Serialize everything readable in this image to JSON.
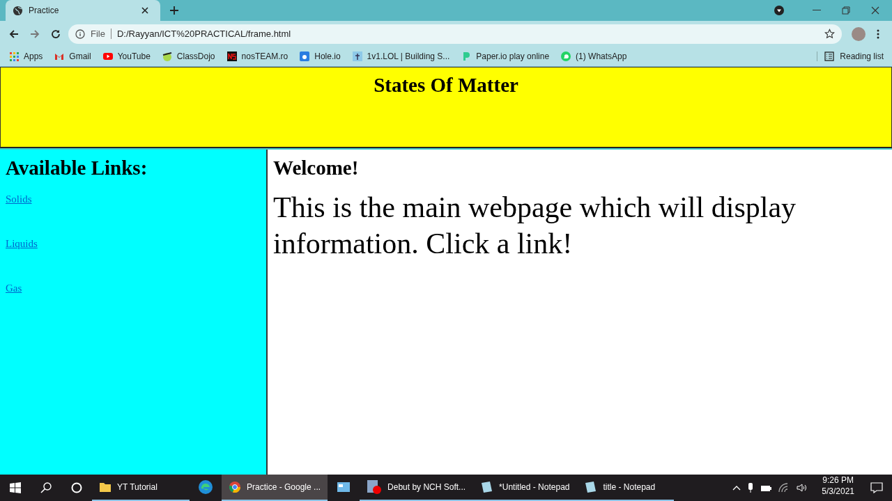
{
  "browser": {
    "tab": {
      "title": "Practice"
    },
    "address": {
      "scheme": "File",
      "url": "D:/Rayyan/ICT%20PRACTICAL/frame.html"
    },
    "bookmarks": [
      {
        "label": "Apps",
        "kind": "apps"
      },
      {
        "label": "Gmail",
        "kind": "gmail"
      },
      {
        "label": "YouTube",
        "kind": "youtube"
      },
      {
        "label": "ClassDojo",
        "kind": "dojo"
      },
      {
        "label": "nosTEAM.ro",
        "kind": "ns"
      },
      {
        "label": "Hole.io",
        "kind": "hole"
      },
      {
        "label": "1v1.LOL | Building S...",
        "kind": "lol"
      },
      {
        "label": "Paper.io play online",
        "kind": "paper"
      },
      {
        "label": "(1) WhatsApp",
        "kind": "whatsapp"
      }
    ],
    "reading_list": "Reading list"
  },
  "page": {
    "header": "States Of Matter",
    "sidebar": {
      "heading": "Available Links:",
      "links": [
        "Solids",
        "Liquids",
        "Gas"
      ]
    },
    "main": {
      "heading": "Welcome!",
      "text": "This is the main webpage which will display information. Click a link!"
    }
  },
  "taskbar": {
    "apps": [
      {
        "kind": "folder",
        "label": "YT Tutorial",
        "open": true,
        "selected": false
      },
      {
        "kind": "edge",
        "open": false,
        "selected": false
      },
      {
        "kind": "chrome",
        "label": "Practice - Google ...",
        "open": true,
        "selected": true
      },
      {
        "kind": "window",
        "open": false,
        "selected": false
      },
      {
        "kind": "debut",
        "label": "Debut by NCH Soft...",
        "open": true,
        "selected": false
      },
      {
        "kind": "notepad",
        "label": "*Untitled - Notepad",
        "open": true,
        "selected": false
      },
      {
        "kind": "notepad",
        "label": "title - Notepad",
        "open": true,
        "selected": false
      }
    ],
    "time": "9:26 PM",
    "date": "5/3/2021"
  }
}
